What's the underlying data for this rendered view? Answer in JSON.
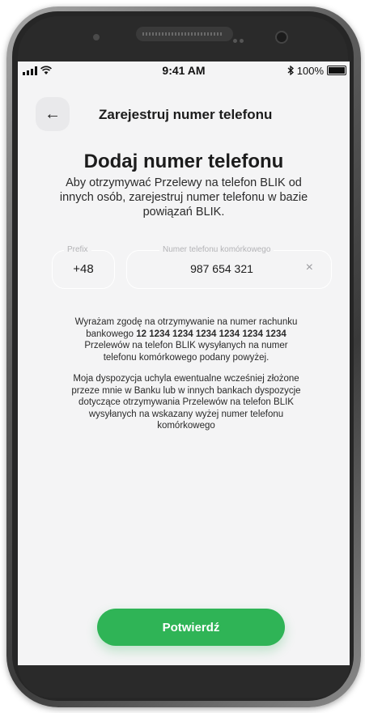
{
  "status_bar": {
    "time": "9:41 AM",
    "battery": "100%",
    "signal_icon": "cellular-signal-icon",
    "wifi_icon": "wifi-icon",
    "bluetooth_icon": "bluetooth-icon",
    "battery_icon": "battery-icon"
  },
  "header": {
    "back_icon": "arrow-left-icon",
    "back_glyph": "←",
    "title": "Zarejestruj numer telefonu"
  },
  "main": {
    "headline": "Dodaj numer telefonu",
    "intro": "Aby otrzymywać Przelewy na telefon BLIK od innych osób, zarejestruj numer telefonu w bazie powiązań BLIK.",
    "prefix_field": {
      "label": "Prefix",
      "value": "+48"
    },
    "phone_field": {
      "label": "Numer telefonu komórkowego",
      "value": "987 654 321",
      "clear_glyph": "×"
    },
    "consent": {
      "text_before": "Wyrażam zgodę na otrzymywanie na numer rachunku bankowego ",
      "account_number": "12 1234 1234 1234 1234 1234 1234",
      "text_after": " Przelewów na telefon BLIK wysyłanych na numer telefonu komórkowego podany powyżej."
    },
    "disposition": "Moja dyspozycja uchyla ewentualne wcześniej złożone przeze mnie w Banku lub w innych bankach dyspozycje dotyczące otrzymywania Przelewów na telefon BLIK wysyłanych na wskazany wyżej numer telefonu komórkowego"
  },
  "footer": {
    "confirm_label": "Potwierdź"
  },
  "colors": {
    "accent_green": "#2fb456",
    "screen_bg": "#f4f4f5",
    "text_dark": "#1c1c1c"
  }
}
